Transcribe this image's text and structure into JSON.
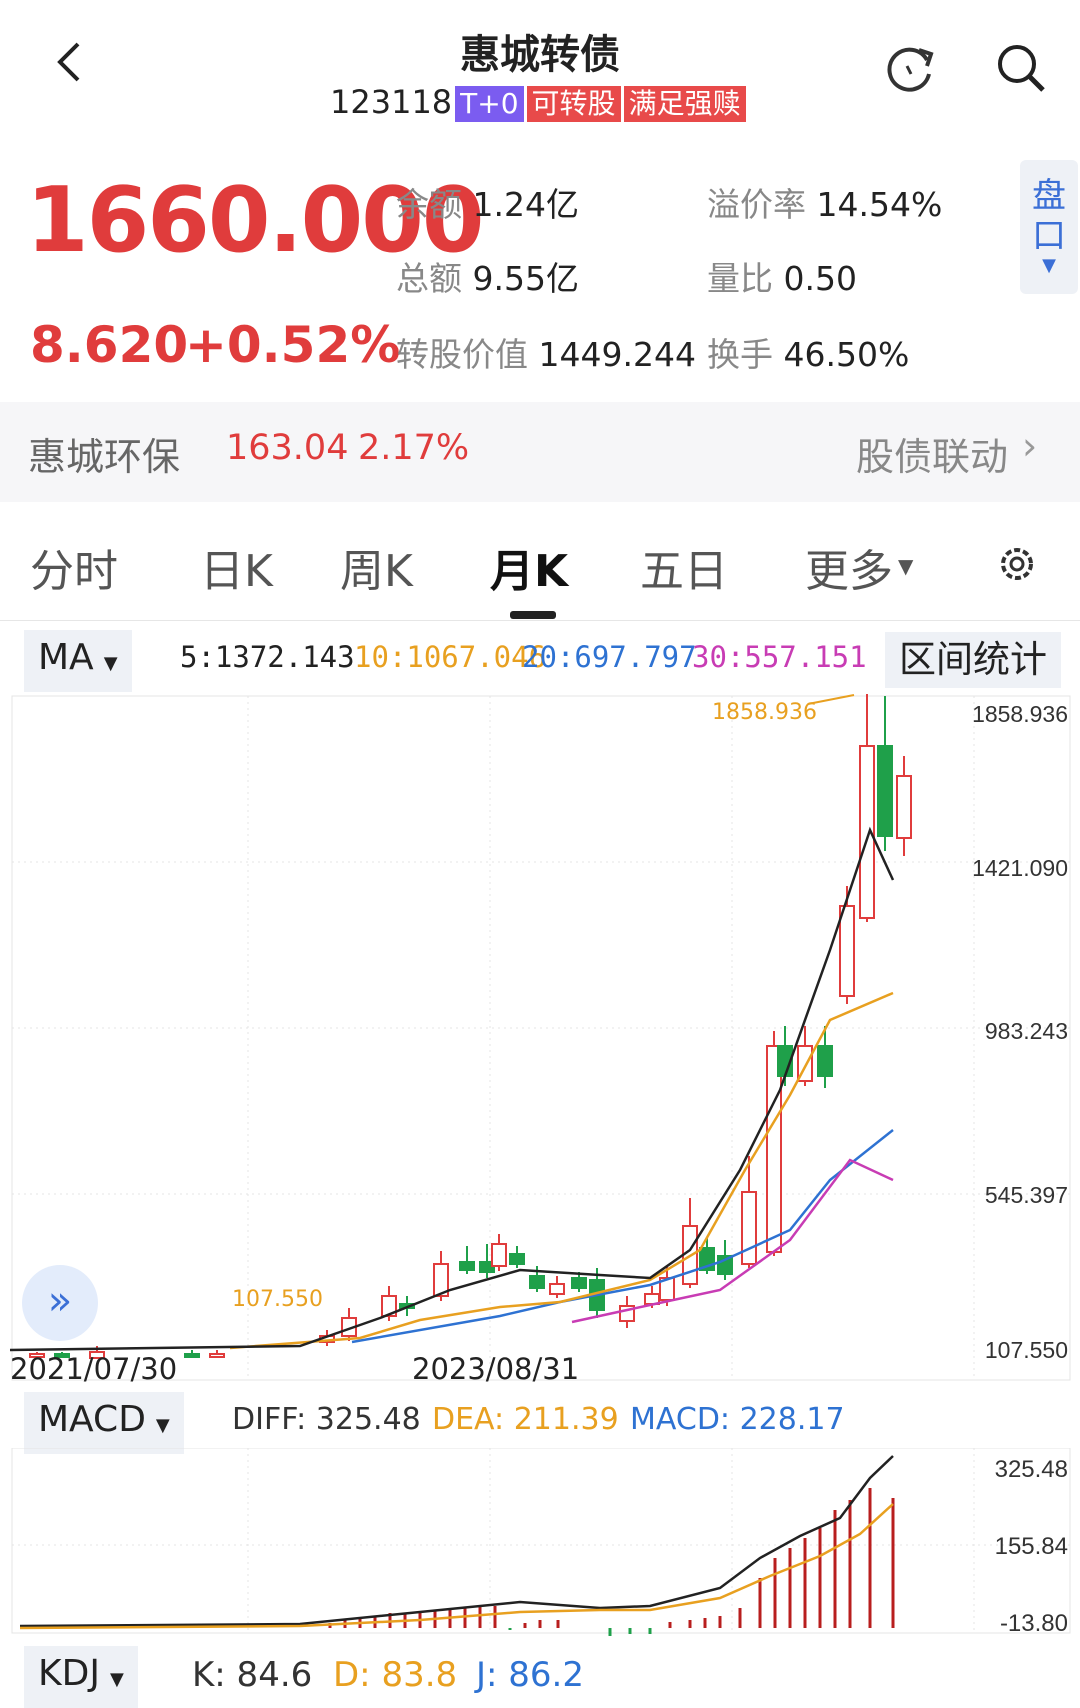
{
  "header": {
    "title": "惠城转债",
    "code": "123118",
    "tags": [
      {
        "text": "T+0",
        "color": "#7b5cf0"
      },
      {
        "text": "可转股",
        "color": "#e84a4a"
      },
      {
        "text": "满足强赎",
        "color": "#e84a4a"
      }
    ]
  },
  "quote": {
    "price": "1660.000",
    "change": "8.620",
    "change_pct": "+0.52%",
    "stats": [
      {
        "label": "余额",
        "value": "1.24亿"
      },
      {
        "label": "溢价率",
        "value": "14.54%"
      },
      {
        "label": "总额",
        "value": "9.55亿"
      },
      {
        "label": "量比",
        "value": "0.50"
      },
      {
        "label": "转股价值",
        "value": "1449.244"
      },
      {
        "label": "换手",
        "value": "46.50%"
      }
    ],
    "panel_btn": "盘口"
  },
  "stock": {
    "name": "惠城环保",
    "price": "163.04",
    "pct": "2.17%",
    "link": "股债联动"
  },
  "tabs": [
    "分时",
    "日K",
    "周K",
    "月K",
    "五日",
    "更多"
  ],
  "active_tab": "月K",
  "ma": {
    "selector": "MA",
    "ma5": "5:1372.143",
    "ma10": "10:1067.046",
    "ma20": "20:697.797",
    "ma30": "30:557.151",
    "range_btn": "区间统计"
  },
  "chart_axis": {
    "y": [
      "1858.936",
      "1421.090",
      "983.243",
      "545.397",
      "107.550"
    ],
    "x": [
      "2021/07/30",
      "2023/08/31"
    ],
    "high_label": "1858.936",
    "low_label": "107.550"
  },
  "macd": {
    "selector": "MACD",
    "diff": "DIFF: 325.48",
    "dea": "DEA: 211.39",
    "macd": "MACD: 228.17",
    "y": [
      "325.48",
      "155.84",
      "-13.80"
    ]
  },
  "kdj": {
    "selector": "KDJ",
    "k": "K: 84.6",
    "d": "D: 83.8",
    "j": "J: 86.2"
  },
  "colors": {
    "up": "#e03c3c",
    "down": "#1fa04a",
    "ma5": "#222",
    "ma10": "#e8a020",
    "ma20": "#2e72d2",
    "ma30": "#c83cb4"
  }
}
